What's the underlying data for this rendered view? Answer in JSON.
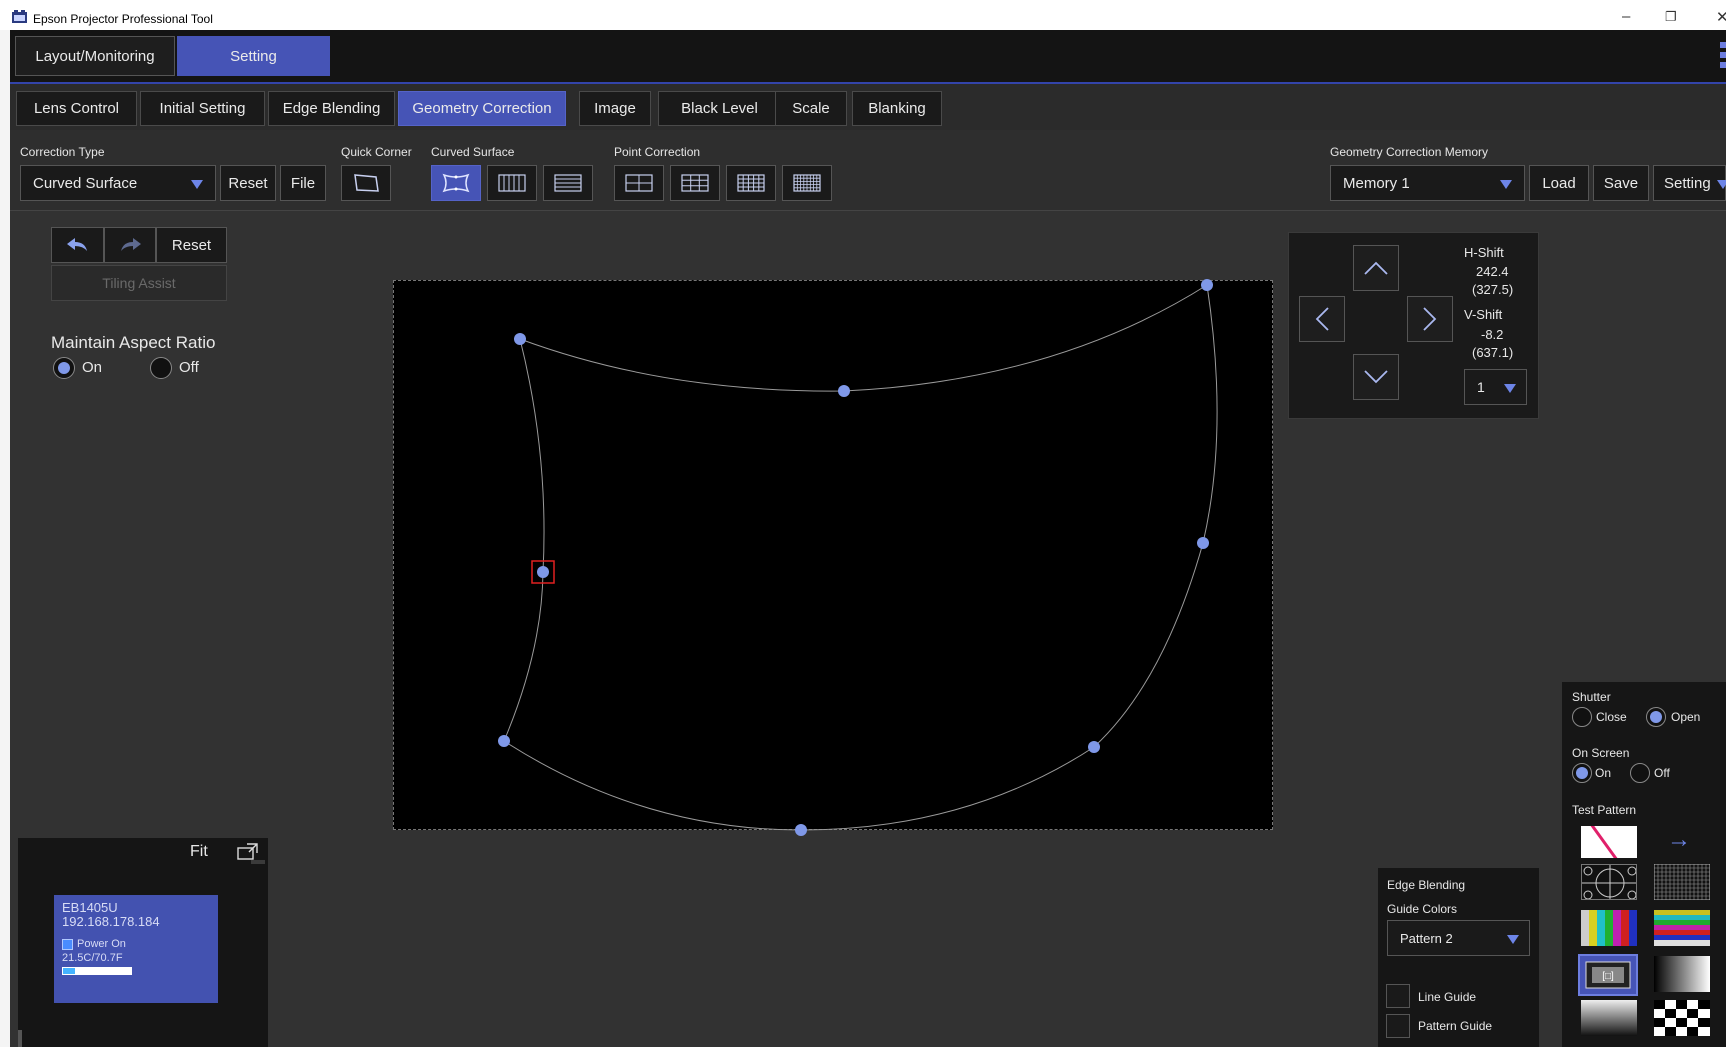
{
  "window": {
    "title": "Epson Projector Professional Tool",
    "minimize_glyph": "–",
    "restore_glyph": "❐",
    "close_glyph": "✕"
  },
  "main_tabs": [
    {
      "label": "Layout/Monitoring",
      "active": false
    },
    {
      "label": "Setting",
      "active": true
    }
  ],
  "sub_tabs": [
    {
      "label": "Lens Control",
      "active": false
    },
    {
      "label": "Initial Setting",
      "active": false
    },
    {
      "label": "Edge Blending",
      "active": false
    },
    {
      "label": "Geometry Correction",
      "active": true
    },
    {
      "label": "Image",
      "active": false
    },
    {
      "label": "Black Level",
      "active": false
    },
    {
      "label": "Scale",
      "active": false
    },
    {
      "label": "Blanking",
      "active": false
    }
  ],
  "toolbar": {
    "correction_type_label": "Correction Type",
    "correction_type_value": "Curved Surface",
    "reset_label": "Reset",
    "file_label": "File",
    "quick_corner_label": "Quick Corner",
    "curved_surface_label": "Curved Surface",
    "point_correction_label": "Point Correction",
    "memory_label": "Geometry Correction Memory",
    "memory_value": "Memory 1",
    "load_label": "Load",
    "save_label": "Save",
    "setting_label": "Setting"
  },
  "left_controls": {
    "reset_label": "Reset",
    "tiling_assist_label": "Tiling Assist",
    "maintain_aspect_label": "Maintain Aspect Ratio",
    "on_label": "On",
    "off_label": "Off",
    "aspect_selected": "On"
  },
  "shift_panel": {
    "h_shift_label": "H-Shift",
    "h_shift_value": "242.4",
    "h_shift_sub": "(327.5)",
    "v_shift_label": "V-Shift",
    "v_shift_value": "-8.2",
    "v_shift_sub": "(637.1)",
    "step_value": "1"
  },
  "preview": {
    "fit_label": "Fit",
    "model": "EB1405U",
    "ip": "192.168.178.184",
    "power_status": "Power On",
    "temperature": "21.5C/70.7F"
  },
  "edge_blending": {
    "title": "Edge Blending",
    "guide_colors_label": "Guide Colors",
    "guide_colors_value": "Pattern 2",
    "line_guide_label": "Line Guide",
    "pattern_guide_label": "Pattern Guide"
  },
  "right_panel": {
    "shutter_label": "Shutter",
    "close_label": "Close",
    "open_label": "Open",
    "shutter_selected": "Open",
    "on_screen_label": "On Screen",
    "on_label": "On",
    "off_label": "Off",
    "on_screen_selected": "On",
    "test_pattern_label": "Test Pattern",
    "next_arrow": "→"
  },
  "colors": {
    "accent": "#4654b6",
    "point": "#7f98e8",
    "selected_point_frame": "#e02020",
    "background": "#323232"
  }
}
